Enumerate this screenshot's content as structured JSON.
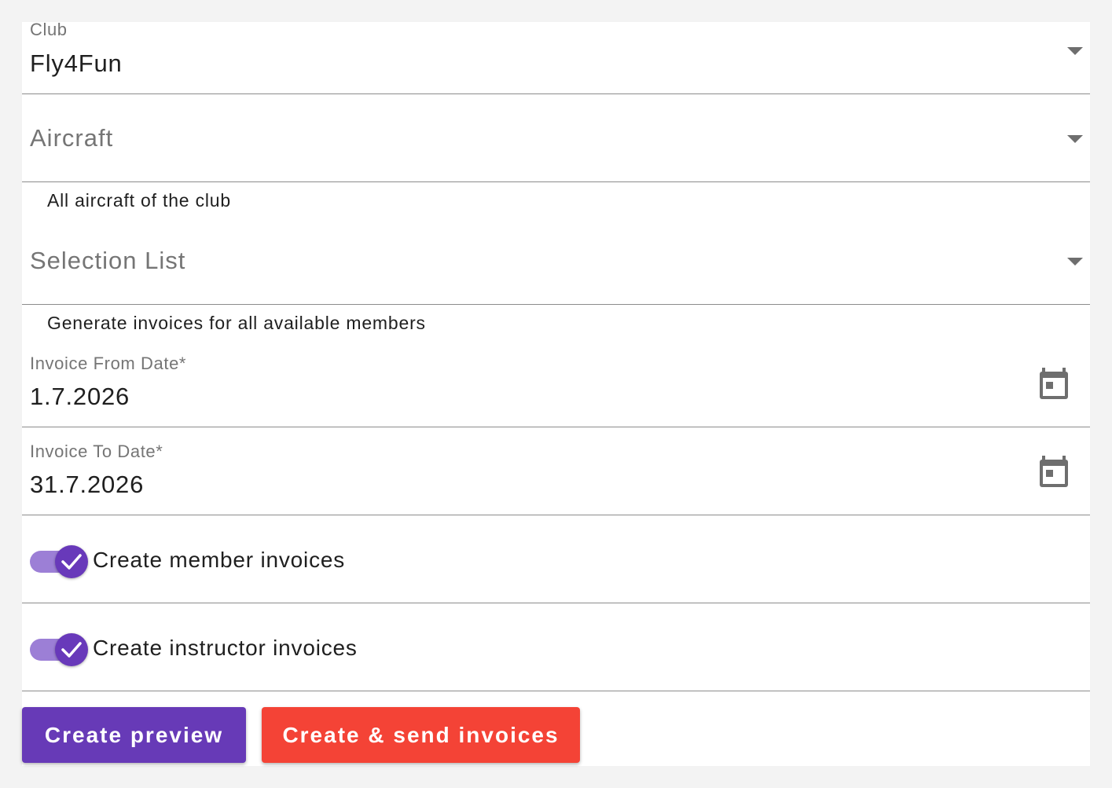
{
  "form": {
    "club": {
      "label": "Club",
      "value": "Fly4Fun"
    },
    "aircraft": {
      "placeholder": "Aircraft",
      "hint": "All aircraft of the club"
    },
    "selection_list": {
      "placeholder": "Selection List",
      "hint": "Generate invoices for all available members"
    },
    "from_date": {
      "label": "Invoice From Date*",
      "value": "1.7.2026"
    },
    "to_date": {
      "label": "Invoice To Date*",
      "value": "31.7.2026"
    },
    "member_toggle": {
      "label": "Create member invoices",
      "checked": true
    },
    "instructor_toggle": {
      "label": "Create instructor invoices",
      "checked": true
    }
  },
  "actions": {
    "preview_label": "Create preview",
    "send_label": "Create & send invoices"
  },
  "colors": {
    "primary": "#673ab7",
    "warn": "#f44336",
    "toggle_track": "#9c7fd6"
  },
  "icons": {
    "dropdown": "arrow-drop-down-icon",
    "calendar": "calendar-icon",
    "check": "check-icon"
  }
}
